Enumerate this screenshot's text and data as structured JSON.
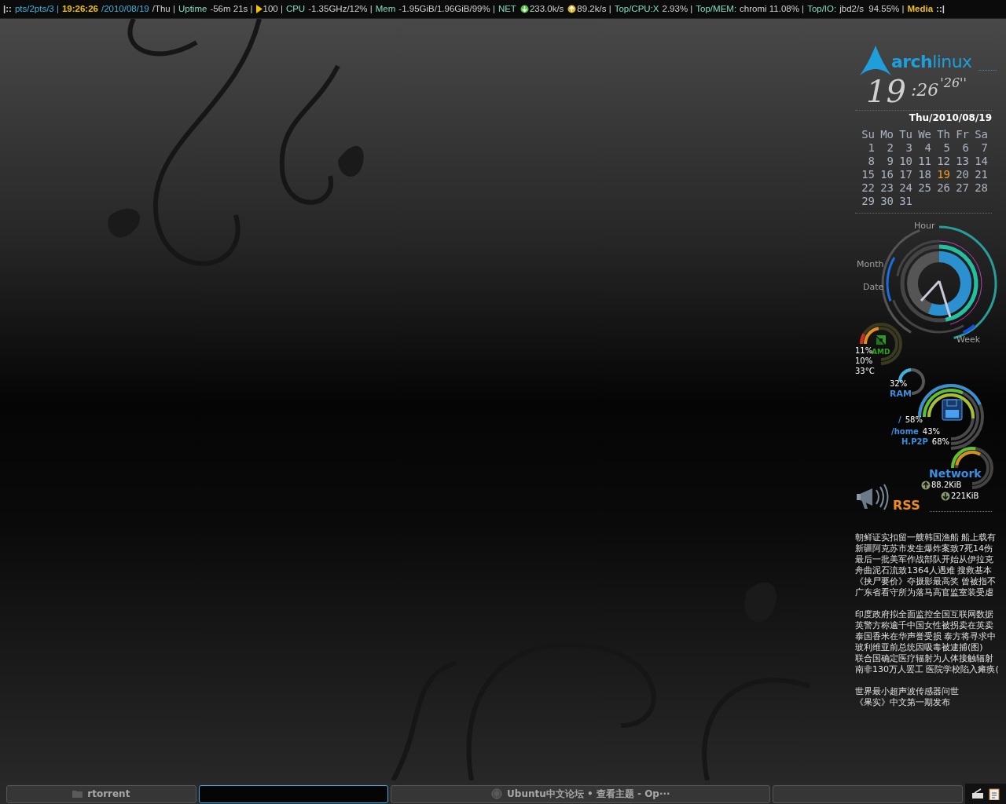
{
  "top_bar": {
    "segments": [
      {
        "kind": "text",
        "text": "|::",
        "color": "#d0d0d0",
        "bold": true
      },
      {
        "kind": "text",
        "text": "pts/2pts/3 |",
        "color": "#3fb4e0",
        "bold": false
      },
      {
        "kind": "text",
        "text": "19:26:26",
        "color": "#f2c200",
        "bold": true
      },
      {
        "kind": "text",
        "text": "/2010/08/19",
        "color": "#3fb4e0",
        "bold": false
      },
      {
        "kind": "text",
        "text": "/Thu |",
        "color": "#d0d0d0",
        "bold": false
      },
      {
        "kind": "text",
        "text": "Uptime",
        "color": "#7fe0c0",
        "bold": false
      },
      {
        "kind": "text",
        "text": "-56m 21s |",
        "color": "#d0d0d0",
        "bold": false
      },
      {
        "kind": "play",
        "text": "100 |",
        "color": "#d0d0d0",
        "bold": false
      },
      {
        "kind": "text",
        "text": "CPU",
        "color": "#7fe0c0",
        "bold": false
      },
      {
        "kind": "text",
        "text": "-1.35GHz/12% |",
        "color": "#d0d0d0",
        "bold": false
      },
      {
        "kind": "text",
        "text": "Mem",
        "color": "#7fe0c0",
        "bold": false
      },
      {
        "kind": "text",
        "text": "-1.95GiB/1.96GiB/99% |",
        "color": "#d0d0d0",
        "bold": false
      },
      {
        "kind": "text",
        "text": "NET",
        "color": "#7fe0c0",
        "bold": false
      },
      {
        "kind": "down",
        "text": "233.0k/s",
        "color": "#d0d0d0",
        "bold": false
      },
      {
        "kind": "up",
        "text": "89.2k/s |",
        "color": "#d0d0d0",
        "bold": false
      },
      {
        "kind": "text",
        "text": "Top/CPU:X",
        "color": "#7fe0c0",
        "bold": false
      },
      {
        "kind": "text",
        "text": "2.93% |",
        "color": "#d0d0d0",
        "bold": false
      },
      {
        "kind": "text",
        "text": "Top/MEM:",
        "color": "#7fe0c0",
        "bold": false
      },
      {
        "kind": "text",
        "text": "chromi 11.08% |",
        "color": "#d0d0d0",
        "bold": false
      },
      {
        "kind": "text",
        "text": "Top/IO:",
        "color": "#7fe0c0",
        "bold": false
      },
      {
        "kind": "text",
        "text": "jbd2/s  94.55% |",
        "color": "#d0d0d0",
        "bold": false
      },
      {
        "kind": "text",
        "text": "Media",
        "color": "#f2c200",
        "bold": true
      },
      {
        "kind": "text",
        "text": "::|",
        "color": "#d0d0d0",
        "bold": true
      }
    ]
  },
  "conky": {
    "logo": {
      "part_1": "arch",
      "part_2": "linux"
    },
    "clock": {
      "hours": "19",
      "minutes": ":26",
      "seconds": "'26''"
    },
    "date": "Thu/2010/08/19",
    "calendar": {
      "weekdays": [
        "Su",
        "Mo",
        "Tu",
        "We",
        "Th",
        "Fr",
        "Sa"
      ],
      "weeks": [
        [
          {
            "day": "1",
            "selected": false
          },
          {
            "day": "2",
            "selected": false
          },
          {
            "day": "3",
            "selected": false
          },
          {
            "day": "4",
            "selected": false
          },
          {
            "day": "5",
            "selected": false
          },
          {
            "day": "6",
            "selected": false
          },
          {
            "day": "7",
            "selected": false
          }
        ],
        [
          {
            "day": "8",
            "selected": false
          },
          {
            "day": "9",
            "selected": false
          },
          {
            "day": "10",
            "selected": false
          },
          {
            "day": "11",
            "selected": false
          },
          {
            "day": "12",
            "selected": false
          },
          {
            "day": "13",
            "selected": false
          },
          {
            "day": "14",
            "selected": false
          }
        ],
        [
          {
            "day": "15",
            "selected": false
          },
          {
            "day": "16",
            "selected": false
          },
          {
            "day": "17",
            "selected": false
          },
          {
            "day": "18",
            "selected": false
          },
          {
            "day": "19",
            "selected": true
          },
          {
            "day": "20",
            "selected": false
          },
          {
            "day": "21",
            "selected": false
          }
        ],
        [
          {
            "day": "22",
            "selected": false
          },
          {
            "day": "23",
            "selected": false
          },
          {
            "day": "24",
            "selected": false
          },
          {
            "day": "25",
            "selected": false
          },
          {
            "day": "26",
            "selected": false
          },
          {
            "day": "27",
            "selected": false
          },
          {
            "day": "28",
            "selected": false
          }
        ],
        [
          {
            "day": "29",
            "selected": false
          },
          {
            "day": "30",
            "selected": false
          },
          {
            "day": "31",
            "selected": false
          }
        ]
      ]
    },
    "clock_labels": [
      "Hour",
      "Month",
      "Date",
      "Week"
    ],
    "cpu": {
      "badge": "AMD",
      "cores": [
        "11%",
        "10%"
      ],
      "temperature": "33°C"
    },
    "ram": {
      "reading": "32%",
      "label": "RAM"
    },
    "disks": [
      {
        "mount": "/",
        "reading": "58%"
      },
      {
        "mount": "/home",
        "reading": "43%"
      },
      {
        "mount": "H.P2P",
        "reading": "68%"
      }
    ],
    "network": {
      "title": "Network",
      "up": "88.2KiB",
      "down": "221KiB"
    },
    "rss": {
      "title": "RSS",
      "groups": [
        [
          "朝鲜证实扣留一艘韩国渔船 船上载有",
          "新疆阿克苏市发生爆炸案致7死14伤",
          "最后一批美军作战部队开始从伊拉克",
          "舟曲泥石流致1364人遇难 搜救基本",
          "《挟尸要价》夺摄影最高奖 曾被指不",
          "广东省看守所为落马高官监室装受虐"
        ],
        [
          "印度政府拟全面监控全国互联网数据",
          "英警方称逾千中国女性被拐卖在英卖",
          "泰国香米在华声誉受损 泰方将寻求中",
          "玻利维亚前总统因吸毒被逮捕(图)",
          "联合国确定医疗辐射为人体接触辐射",
          "南非130万人罢工 医院学校陷入瘫痪("
        ],
        [
          "世界最小超声波传感器问世",
          "《果实》中文第一期发布"
        ]
      ]
    }
  },
  "taskbar": {
    "tasks": [
      {
        "kind": "folder",
        "label": "rtorrent",
        "selected": false
      },
      {
        "kind": "blank",
        "selected": true
      },
      {
        "kind": "browser",
        "label": "Ubuntu中文论坛 • 查看主题 - Op···",
        "selected": false
      },
      {
        "kind": "blank",
        "selected": false
      }
    ]
  }
}
